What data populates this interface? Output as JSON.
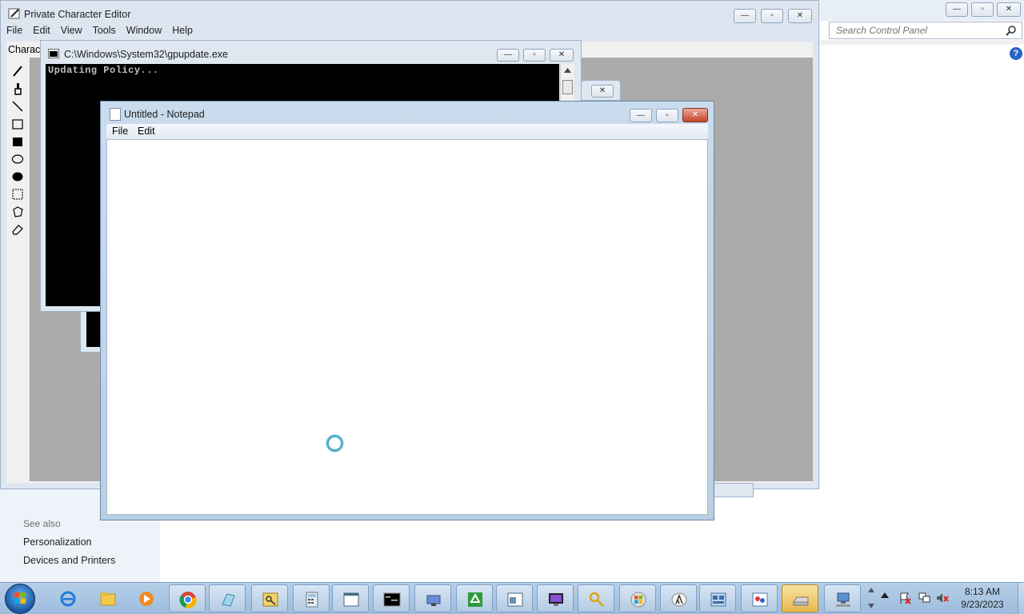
{
  "control_panel": {
    "search_placeholder": "Search Control Panel",
    "help_glyph": "?",
    "see_also_heading": "See also",
    "links": [
      "Personalization",
      "Devices and Printers"
    ]
  },
  "pce": {
    "title": "Private Character Editor",
    "menu": [
      "File",
      "Edit",
      "View",
      "Tools",
      "Window",
      "Help"
    ],
    "panel_label": "Charact",
    "tools": [
      "pencil",
      "brush",
      "line",
      "hollow-rectangle",
      "filled-rectangle",
      "hollow-ellipse",
      "filled-ellipse",
      "rectangular-selection",
      "freeform-selection",
      "eraser"
    ]
  },
  "console": {
    "title": "C:\\Windows\\System32\\gpupdate.exe",
    "text": "Updating Policy..."
  },
  "notepad": {
    "title": "Untitled - Notepad",
    "menu": [
      "File",
      "Edit"
    ],
    "content": ""
  },
  "window_buttons": {
    "minimize": "—",
    "maximize": "▫",
    "close": "✕"
  },
  "taskbar": {
    "pinned": [
      "internet-explorer",
      "windows-explorer",
      "media-player",
      "chrome",
      "notepad",
      "credential-manager",
      "calculator",
      "window-app",
      "command-prompt",
      "network-tool",
      "recycle-tool",
      "window-app-2",
      "display-settings",
      "search-key",
      "windows-logo-app",
      "lambda-app",
      "control-panel",
      "paint",
      "removable-drive",
      "network-connection"
    ],
    "active_index": 18,
    "clock_time": "8:13 AM",
    "clock_date": "9/23/2023"
  }
}
